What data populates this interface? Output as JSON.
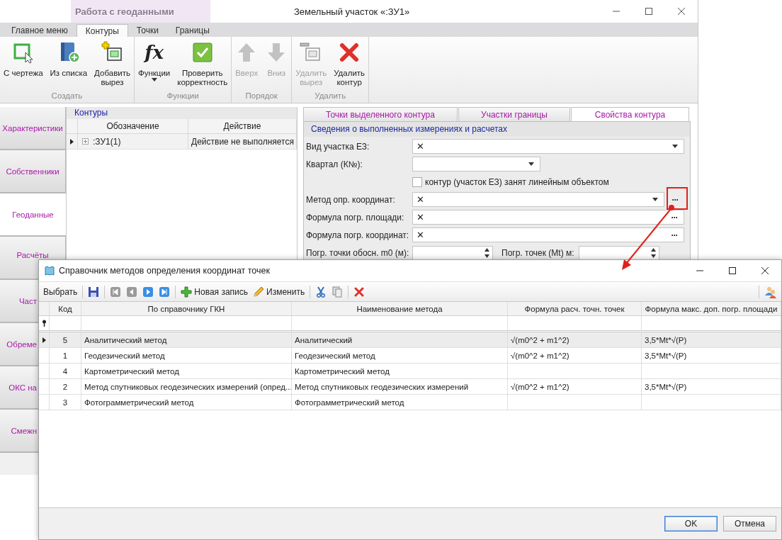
{
  "window": {
    "context_tab": "Работа с геоданными",
    "title": "Земельный участок «:ЗУ1»"
  },
  "ribbon_tabs": [
    {
      "label": "Главное меню",
      "selected": false
    },
    {
      "label": "Контуры",
      "selected": true
    },
    {
      "label": "Точки",
      "selected": false
    },
    {
      "label": "Границы",
      "selected": false
    }
  ],
  "ribbon_groups": [
    {
      "label": "Создать",
      "buttons": [
        {
          "kind": "from-drawing",
          "lines": [
            "С чертежа"
          ],
          "disabled": false
        },
        {
          "kind": "from-list",
          "lines": [
            "Из списка"
          ],
          "disabled": false
        },
        {
          "kind": "add-cut",
          "lines": [
            "Добавить",
            "вырез"
          ],
          "disabled": false
        }
      ]
    },
    {
      "label": "Функции",
      "buttons": [
        {
          "kind": "glyph",
          "glyph": "fx",
          "lines": [
            "Функции"
          ],
          "disabled": false,
          "dropdown": true
        },
        {
          "kind": "check",
          "lines": [
            "Проверить",
            "корректность"
          ],
          "disabled": false
        }
      ]
    },
    {
      "label": "Порядок",
      "buttons": [
        {
          "kind": "up",
          "lines": [
            "Вверх"
          ],
          "disabled": true
        },
        {
          "kind": "down",
          "lines": [
            "Вниз"
          ],
          "disabled": true
        }
      ]
    },
    {
      "label": "Удалить",
      "buttons": [
        {
          "kind": "remove-cut",
          "lines": [
            "Удалить",
            "вырез"
          ],
          "disabled": true
        },
        {
          "kind": "delete",
          "lines": [
            "Удалить",
            "контур"
          ],
          "disabled": false
        }
      ]
    }
  ],
  "side_tabs": [
    {
      "label": "Характеристики",
      "selected": false
    },
    {
      "label": "Собственники",
      "selected": false
    },
    {
      "label": "Геоданные",
      "selected": true
    },
    {
      "label": "Расчёты",
      "selected": false
    },
    {
      "label": "Част",
      "selected": false
    },
    {
      "label": "Обреме",
      "selected": false
    },
    {
      "label": "ОКС на",
      "selected": false
    },
    {
      "label": "Смежн",
      "selected": false
    }
  ],
  "contours": {
    "title": "Контуры",
    "columns": [
      "Обозначение",
      "Действие"
    ],
    "rows": [
      {
        "designation": ":ЗУ1(1)",
        "action": "Действие не выполняется",
        "current": true,
        "expanded": false
      }
    ]
  },
  "properties": {
    "tabs": [
      {
        "label": "Точки выделенного контура",
        "selected": false
      },
      {
        "label": "Участки границы",
        "selected": false
      },
      {
        "label": "Свойства контура",
        "selected": true
      }
    ],
    "group_title": "Сведения о выполненных измерениях и расчетах",
    "fields": [
      {
        "kind": "combo",
        "label": "Вид участка ЕЗ:",
        "value": "✕"
      },
      {
        "kind": "combo-short",
        "label": "Квартал (К№):"
      },
      {
        "kind": "checkbox",
        "label": "контур (участок ЕЗ) занят линейным объектом",
        "checked": false
      },
      {
        "kind": "combo-dots",
        "label": "Метод опр. координат:",
        "value": "✕",
        "button": "···"
      },
      {
        "kind": "dots",
        "label": "Формула погр. площади:",
        "value": "✕",
        "button": "···"
      },
      {
        "kind": "dots",
        "label": "Формула погр. координат:",
        "value": "✕",
        "button": "···"
      },
      {
        "kind": "spin-pair",
        "label": "Погр. точки обосн. m0 (м):",
        "label2": "Погр. точек (Mt) м:"
      }
    ]
  },
  "dialog": {
    "title": "Справочник методов определения координат точек",
    "toolbar": [
      [
        {
          "kind": "text",
          "label": "Выбрать"
        }
      ],
      [
        {
          "kind": "save"
        }
      ],
      [
        {
          "kind": "first",
          "disabled": true
        },
        {
          "kind": "prev",
          "disabled": true
        },
        {
          "kind": "next",
          "disabled": false
        },
        {
          "kind": "last",
          "disabled": false
        }
      ],
      [
        {
          "kind": "add",
          "label": "Новая запись"
        },
        {
          "kind": "edit",
          "label": "Изменить"
        }
      ],
      [
        {
          "kind": "cut"
        },
        {
          "kind": "copy"
        }
      ],
      [
        {
          "kind": "delete"
        }
      ]
    ],
    "toolbar_right": [
      {
        "kind": "users"
      }
    ],
    "columns": [
      "Код",
      "По справочнику ГКН",
      "Наименование метода",
      "Формула расч. точн. точек",
      "Формула макс. доп. погр. площади"
    ],
    "rows": [
      {
        "code": "5",
        "gkn": "Аналитический метод",
        "name": "Аналитический",
        "formula_points": "√(m0^2 + m1^2)",
        "formula_area": "3,5*Mt*√(P)",
        "selected": true
      },
      {
        "code": "1",
        "gkn": "Геодезический метод",
        "name": "Геодезический метод",
        "formula_points": "√(m0^2 + m1^2)",
        "formula_area": "3,5*Mt*√(P)",
        "selected": false
      },
      {
        "code": "4",
        "gkn": "Картометрический метод",
        "name": "Картометрический метод",
        "selected": false
      },
      {
        "code": "2",
        "gkn": "Метод спутниковых геодезических измерений (опред...",
        "name": "Метод спутниковых геодезических измерений",
        "formula_points": "√(m0^2 + m1^2)",
        "formula_area": "3,5*Mt*√(P)",
        "selected": false
      },
      {
        "code": "3",
        "gkn": "Фотограмметрический метод",
        "name": "Фотограмметрический метод",
        "selected": false
      }
    ],
    "buttons": [
      {
        "label": "OK",
        "default": true
      },
      {
        "label": "Отмена",
        "default": false
      }
    ]
  }
}
